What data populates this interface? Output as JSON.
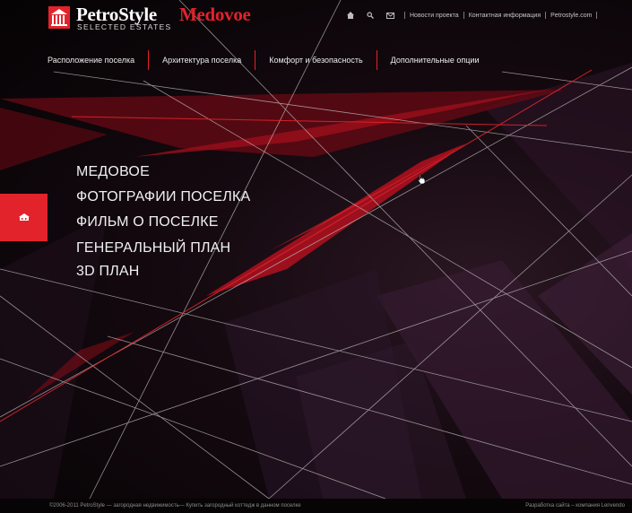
{
  "brand": {
    "name_part1": "PetroStyle",
    "name_part2": "Medovoe",
    "tagline": "SELECTED ESTATES",
    "accent_color": "#e2232b"
  },
  "topbar": {
    "icons": [
      "home-icon",
      "search-icon",
      "mail-icon"
    ],
    "links": [
      "Новости проекта",
      "Контактная информация",
      "Petrostyle.com"
    ]
  },
  "mainnav": {
    "items": [
      "Расположение поселка",
      "Архитектура поселка",
      "Комфорт и безопасность",
      "Дополнительные опции"
    ]
  },
  "menu": {
    "items": [
      "МЕДОВОЕ",
      "ФОТОГРАФИИ ПОСЕЛКА",
      "ФИЛЬМ О ПОСЕЛКЕ",
      "ГЕНЕРАЛЬНЫЙ ПЛАН",
      "3D ПЛАН"
    ]
  },
  "side_tab": {
    "icon": "estate-icon"
  },
  "footer": {
    "left": "©2006-2011 PetroStyle — загородная недвижимость— Купить загородный коттедж в данном поселке",
    "right": "Разработка сайта – компания Lenvendo"
  }
}
